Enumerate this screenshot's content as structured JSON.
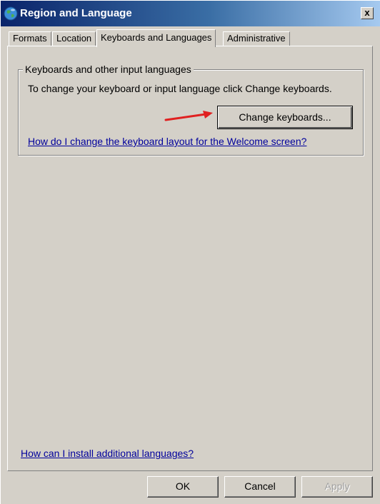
{
  "window": {
    "title": "Region and Language",
    "close_label": "x"
  },
  "tabs": [
    {
      "label": "Formats"
    },
    {
      "label": "Location"
    },
    {
      "label": "Keyboards and Languages"
    },
    {
      "label": "Administrative"
    }
  ],
  "active_tab": "Keyboards and Languages",
  "group": {
    "legend": "Keyboards and other input languages",
    "text": "To change your keyboard or input language click Change keyboards.",
    "button_label": "Change keyboards...",
    "link": "How do I change the keyboard layout for the Welcome screen?"
  },
  "install_link": "How can I install additional languages?",
  "footer": {
    "ok": "OK",
    "cancel": "Cancel",
    "apply": "Apply"
  },
  "colors": {
    "arrow": "#e02020",
    "link": "#00009c",
    "titlebar": "#0a246a"
  },
  "icons": [
    "globe-icon",
    "close-icon",
    "red-arrow-annotation"
  ]
}
